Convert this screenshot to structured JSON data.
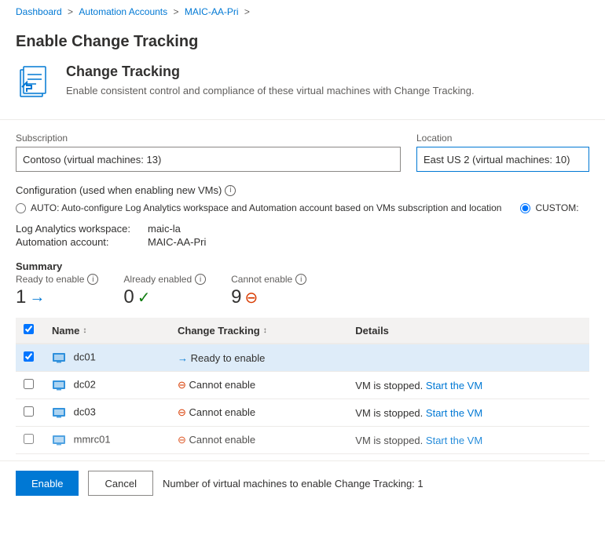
{
  "breadcrumb": {
    "items": [
      {
        "label": "Dashboard",
        "href": "#"
      },
      {
        "label": "Automation Accounts",
        "href": "#"
      },
      {
        "label": "MAIC-AA-Pri",
        "href": "#"
      }
    ],
    "separator": ">"
  },
  "page": {
    "title": "Enable Change Tracking"
  },
  "header": {
    "icon_label": "change-tracking-icon",
    "title": "Change Tracking",
    "description": "Enable consistent control and compliance of these virtual machines with Change Tracking."
  },
  "form": {
    "subscription_label": "Subscription",
    "subscription_value": "Contoso (virtual machines: 13)",
    "location_label": "Location",
    "location_value": "East US 2 (virtual machines: 10)"
  },
  "configuration": {
    "label": "Configuration (used when enabling new VMs)",
    "options": [
      {
        "id": "auto",
        "label": "AUTO: Auto-configure Log Analytics workspace and Automation account based on VMs subscription and location"
      },
      {
        "id": "custom",
        "label": "CUSTOM:"
      }
    ],
    "selected": "custom"
  },
  "details": {
    "workspace_label": "Log Analytics workspace:",
    "workspace_value": "maic-la",
    "account_label": "Automation account:",
    "account_value": "MAIC-AA-Pri"
  },
  "summary": {
    "title": "Summary",
    "cards": [
      {
        "label": "Ready to enable",
        "value": "1",
        "icon": "arrow"
      },
      {
        "label": "Already enabled",
        "value": "0",
        "icon": "check"
      },
      {
        "label": "Cannot enable",
        "value": "9",
        "icon": "block"
      }
    ]
  },
  "table": {
    "columns": [
      {
        "label": "Name",
        "sortable": true
      },
      {
        "label": "Change Tracking",
        "sortable": true
      },
      {
        "label": "Details",
        "sortable": false
      }
    ],
    "rows": [
      {
        "selected": true,
        "name": "dc01",
        "change_tracking": "Ready to enable",
        "tracking_status": "arrow",
        "details": "",
        "details_link": ""
      },
      {
        "selected": false,
        "name": "dc02",
        "change_tracking": "Cannot enable",
        "tracking_status": "block",
        "details": "VM is stopped.",
        "details_link": "Start the VM"
      },
      {
        "selected": false,
        "name": "dc03",
        "change_tracking": "Cannot enable",
        "tracking_status": "block",
        "details": "VM is stopped.",
        "details_link": "Start the VM"
      },
      {
        "selected": false,
        "name": "mmrc01",
        "change_tracking": "Cannot enable",
        "tracking_status": "block",
        "details": "VM is stopped.",
        "details_link": "Start the VM"
      }
    ]
  },
  "footer": {
    "enable_label": "Enable",
    "cancel_label": "Cancel",
    "note": "Number of virtual machines to enable Change Tracking: 1"
  }
}
